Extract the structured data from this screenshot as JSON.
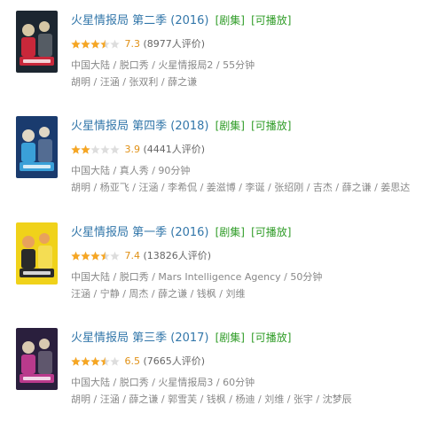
{
  "items": [
    {
      "title": "火星情报局 第二季 (2016)",
      "tag1": "[剧集]",
      "tag2": "[可播放]",
      "rating": 3.5,
      "score": "7.3",
      "count": "(8977人评价)",
      "meta1": "中国大陆 / 脱口秀 / 火星情报局2 / 55分钟",
      "meta2": "胡明 / 汪涵 / 张双利 / 薛之谦",
      "poster_colors": [
        "#1c2630",
        "#c8283a",
        "#d6c7a4"
      ]
    },
    {
      "title": "火星情报局 第四季 (2018)",
      "tag1": "[剧集]",
      "tag2": "[可播放]",
      "rating": 2,
      "score": "3.9",
      "count": "(4441人评价)",
      "meta1": "中国大陆 / 真人秀 / 90分钟",
      "meta2": "胡明 / 杨亚飞 / 汪涵 / 李希侃 / 姜滋博 / 李诞 / 张绍刚 / 吉杰 / 薛之谦 / 姜思达",
      "poster_colors": [
        "#1a3b6e",
        "#3aa0d8",
        "#e0d7c4"
      ]
    },
    {
      "title": "火星情报局 第一季 (2016)",
      "tag1": "[剧集]",
      "tag2": "[可播放]",
      "rating": 3.5,
      "score": "7.4",
      "count": "(13826人评价)",
      "meta1": "中国大陆 / 脱口秀 / Mars Intelligence Agency / 50分钟",
      "meta2": "汪涵 / 宁静 / 周杰 / 薛之谦 / 钱枫 / 刘维",
      "poster_colors": [
        "#f0d21a",
        "#2a2a2a",
        "#e8a25c"
      ]
    },
    {
      "title": "火星情报局 第三季 (2017)",
      "tag1": "[剧集]",
      "tag2": "[可播放]",
      "rating": 3.5,
      "score": "6.5",
      "count": "(7665人评价)",
      "meta1": "中国大陆 / 脱口秀 / 火星情报局3 / 60分钟",
      "meta2": "胡明 / 汪涵 / 薛之谦 / 郭雪芙 / 钱枫 / 杨迪 / 刘维 / 张宇 / 沈梦辰",
      "poster_colors": [
        "#2a1f3d",
        "#b93a8c",
        "#d9c9b0"
      ]
    }
  ]
}
